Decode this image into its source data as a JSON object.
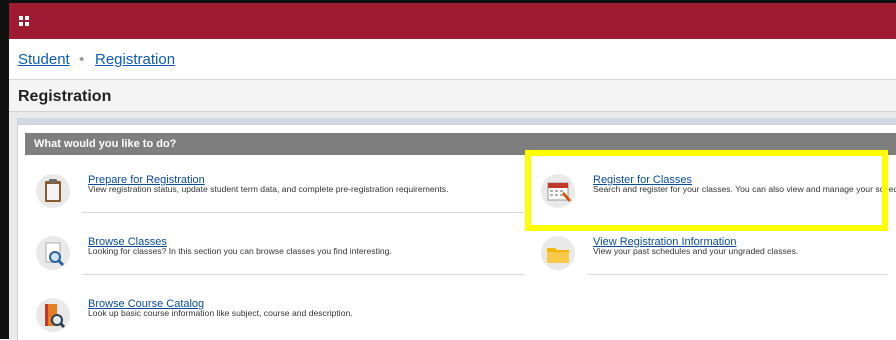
{
  "breadcrumb": {
    "items": [
      {
        "label": "Student"
      },
      {
        "label": "Registration"
      }
    ],
    "separator": "•"
  },
  "page": {
    "title": "Registration"
  },
  "panel": {
    "header": "What would you like to do?",
    "items": [
      {
        "title": "Prepare for Registration",
        "description": "View registration status, update student term data, and complete pre-registration requirements.",
        "icon": "clipboard-icon"
      },
      {
        "title": "Register for Classes",
        "description": "Search and register for your classes. You can also view and manage your schedule.",
        "icon": "calendar-icon"
      },
      {
        "title": "Browse Classes",
        "description": "Looking for classes? In this section you can browse classes you find interesting.",
        "icon": "search-document-icon"
      },
      {
        "title": "View Registration Information",
        "description": "View your past schedules and your ungraded classes.",
        "icon": "folder-icon"
      },
      {
        "title": "Browse Course Catalog",
        "description": "Look up basic course information like subject, course and description.",
        "icon": "book-search-icon"
      }
    ]
  },
  "colors": {
    "brand": "#9e1b32",
    "link": "#0b5cb8",
    "panel_header": "#7f7f7f",
    "highlight": "#ffff00"
  }
}
